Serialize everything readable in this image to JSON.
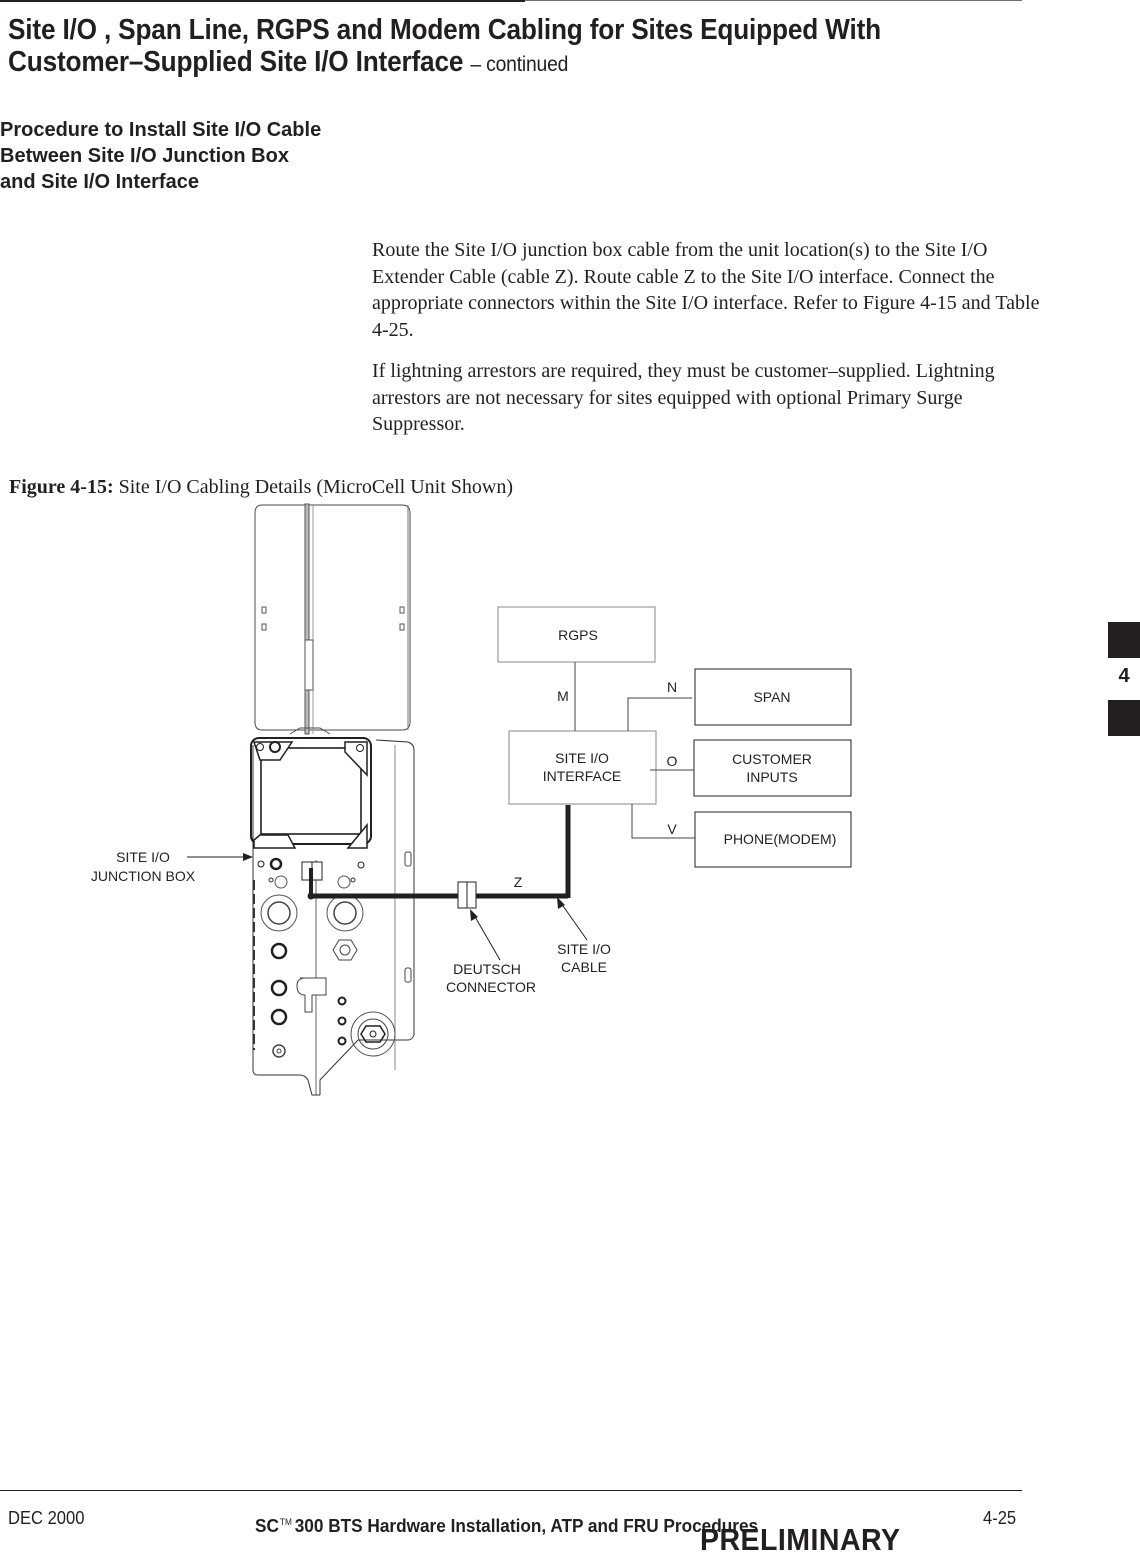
{
  "header": {
    "title_line1": "Site I/O , Span Line, RGPS and Modem Cabling for Sites Equipped With",
    "title_line2": "Customer–Supplied Site I/O Interface",
    "continued": "– continued"
  },
  "section": {
    "side_heading": "Procedure to Install Site I/O Cable Between Site I/O Junction Box and Site I/O Interface",
    "paragraphs": [
      "Route the Site I/O junction box cable from the unit location(s) to the Site I/O Extender Cable (cable Z).  Route cable Z to the Site I/O interface. Connect the appropriate connectors within the Site I/O interface.  Refer to Figure 4-15 and Table 4-25.",
      "If lightning arrestors are required, they must be customer–supplied. Lightning arrestors are not necessary for sites equipped with optional Primary Surge Suppressor."
    ]
  },
  "figure": {
    "caption_label": "Figure 4-15:",
    "caption_text": " Site I/O Cabling Details (MicroCell Unit Shown)",
    "boxes": {
      "rgps": "RGPS",
      "site_io_interface_line1": "SITE I/O",
      "site_io_interface_line2": "INTERFACE",
      "span": "SPAN",
      "customer_inputs_line1": "CUSTOMER",
      "customer_inputs_line2": "INPUTS",
      "phone_modem": "PHONE(MODEM)"
    },
    "cable_labels": {
      "m": "M",
      "n": "N",
      "o": "O",
      "v": "V",
      "z": "Z"
    },
    "callouts": {
      "junction_box_line1": "SITE I/O",
      "junction_box_line2": "JUNCTION BOX",
      "deutsch_line1": "DEUTSCH",
      "deutsch_line2": "CONNECTOR",
      "cable_line1": "SITE I/O",
      "cable_line2": "CABLE"
    }
  },
  "chapter_tab": {
    "number": "4"
  },
  "footer": {
    "date": "DEC 2000",
    "doc_title_prefix": "SC",
    "trademark": "TM",
    "doc_title_rest": "300 BTS Hardware Installation, ATP and FRU Procedures",
    "page": "4-25",
    "status": "PRELIMINARY"
  }
}
